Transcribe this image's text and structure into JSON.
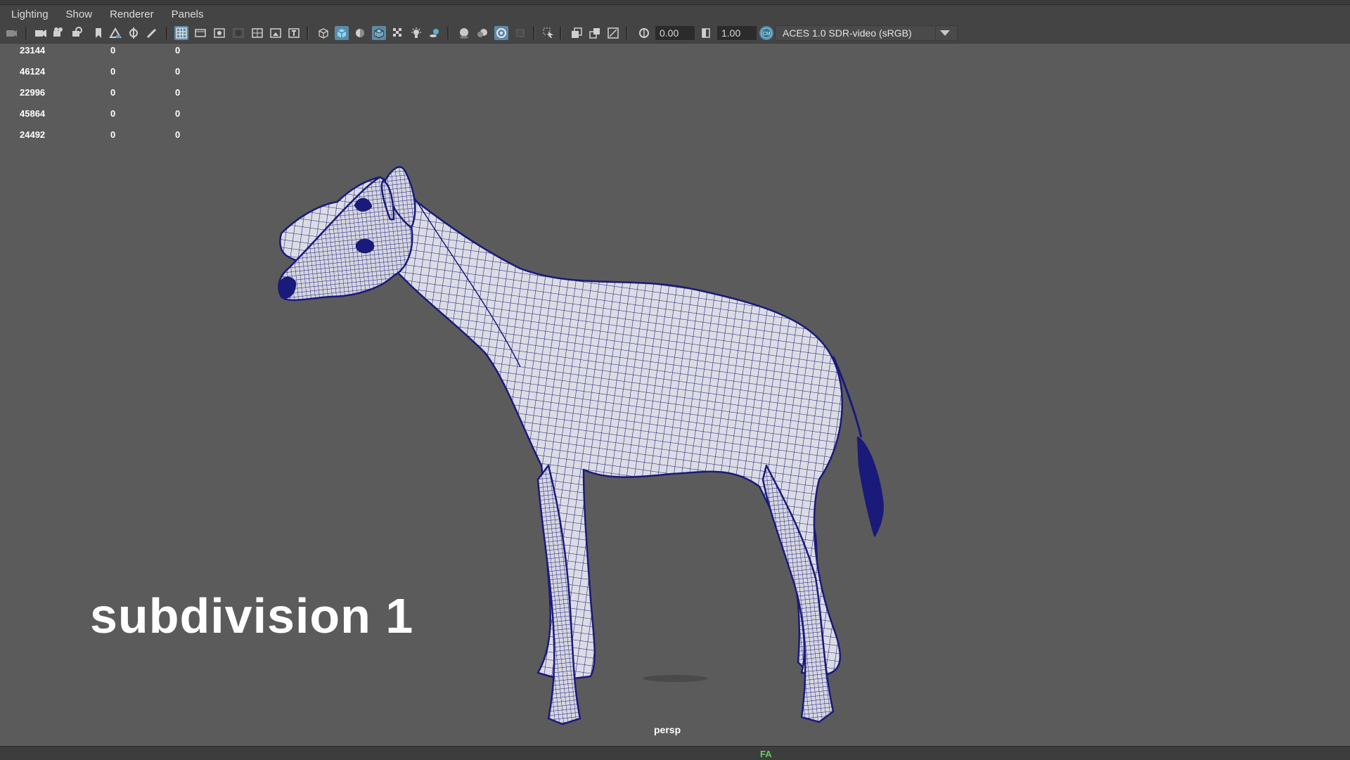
{
  "menubar": {
    "items": [
      "Lighting",
      "Show",
      "Renderer",
      "Panels"
    ]
  },
  "toolbar": {
    "exposure_value": "0.00",
    "gamma_value": "1.00",
    "color_space": "ACES 1.0 SDR-video (sRGB)",
    "icons": [
      "select-camera-icon",
      "camera-attributes-icon",
      "bookmark-icon",
      "image-plane-icon",
      "grease-pencil-icon",
      "grid-icon",
      "film-gate-icon",
      "resolution-gate-icon",
      "gate-mask-icon",
      "field-chart-icon",
      "safe-action-icon",
      "safe-title-icon",
      "wireframe-icon",
      "smooth-shade-icon",
      "default-material-icon",
      "wireframe-on-shaded-icon",
      "xray-icon",
      "use-all-lights-icon",
      "shadows-icon",
      "screen-space-ao-icon",
      "motion-blur-icon",
      "anti-aliasing-icon",
      "depth-of-field-icon",
      "isolate-select-icon",
      "xray-joints-icon",
      "xray-active-components-icon",
      "backface-culling-icon",
      "exposure-icon",
      "gamma-icon",
      "color-management-icon"
    ],
    "accent": "#5c8aa8"
  },
  "hud": {
    "rows": [
      [
        "23144",
        "0",
        "0"
      ],
      [
        "46124",
        "0",
        "0"
      ],
      [
        "22996",
        "0",
        "0"
      ],
      [
        "45864",
        "0",
        "0"
      ],
      [
        "24492",
        "0",
        "0"
      ]
    ]
  },
  "viewport": {
    "overlay_text": "subdivision 1",
    "camera": "persp",
    "background": "#5b5b5b",
    "mesh_color": "#1a1a7a"
  },
  "statusbar": {
    "text": "FA"
  }
}
